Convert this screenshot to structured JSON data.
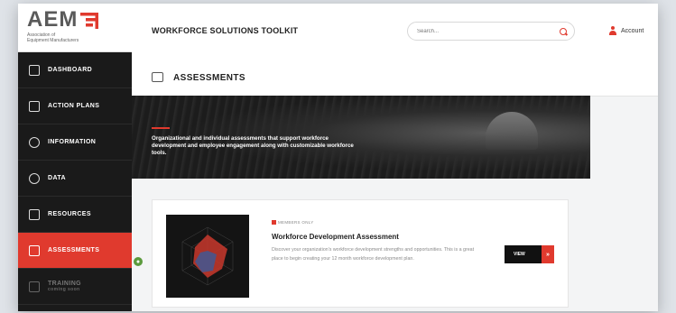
{
  "logo": {
    "wordmark": "AEM",
    "subtitle_line1": "Association of",
    "subtitle_line2": "Equipment Manufacturers",
    "brand_color": "#e03a2e"
  },
  "sidebar": {
    "items": [
      {
        "label": "DASHBOARD",
        "icon": "dashboard-icon"
      },
      {
        "label": "ACTION PLANS",
        "icon": "clipboard-icon"
      },
      {
        "label": "INFORMATION",
        "icon": "info-icon"
      },
      {
        "label": "DATA",
        "icon": "data-icon"
      },
      {
        "label": "RESOURCES",
        "icon": "folder-icon"
      },
      {
        "label": "ASSESSMENTS",
        "icon": "assessment-icon",
        "active": true
      },
      {
        "label": "TRAINING",
        "sub": "coming soon",
        "icon": "graduation-cap-icon"
      }
    ],
    "active_indicator": "●"
  },
  "header": {
    "title": "WORKFORCE SOLUTIONS TOOLKIT",
    "search_placeholder": "Search...",
    "account_label": "Account"
  },
  "section": {
    "title": "ASSESSMENTS"
  },
  "hero": {
    "text": "Organizational and individual assessments that support workforce development and employee engagement along with customizable workforce tools."
  },
  "card": {
    "badge": "MEMBERS ONLY",
    "title": "Workforce Development Assessment",
    "description": "Discover your organization's workforce development strengths and opportunities. This is a great place to begin creating your 12 month workforce development plan.",
    "button_label": "VIEW",
    "button_arrow": "»"
  },
  "colors": {
    "accent": "#e03a2e",
    "sidebar_bg": "#1a1a1a",
    "indicator": "#5b9a3d"
  }
}
